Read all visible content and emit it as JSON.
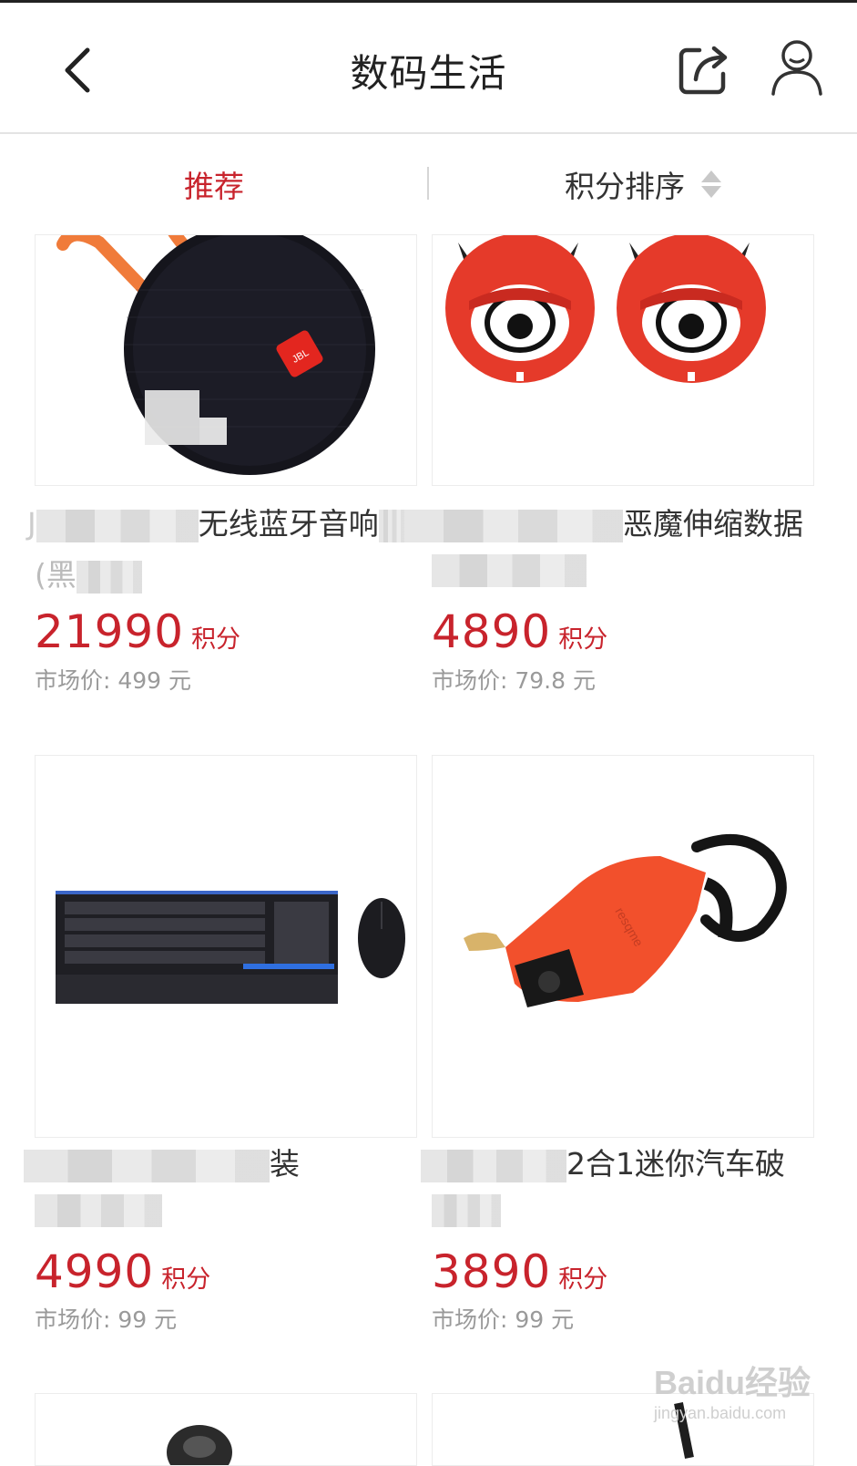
{
  "header": {
    "title": "数码生活"
  },
  "tabs": {
    "recommend": "推荐",
    "points_sort": "积分排序"
  },
  "products": [
    {
      "name_visible": "无线蓝牙音响",
      "name_line2_visible": "(黑",
      "name_prefix_visible": "J",
      "price_points": "21990",
      "points_unit": "积分",
      "market_price": "市场价: 499 元",
      "image": "black-round-bluetooth-speaker"
    },
    {
      "name_visible": "恶魔伸缩数据",
      "name_line2_visible": "",
      "price_points": "4890",
      "points_unit": "积分",
      "market_price": "市场价: 79.8 元",
      "image": "red-devil-cable-winders"
    },
    {
      "name_visible": "装",
      "name_line2_visible": "",
      "price_points": "4990",
      "points_unit": "积分",
      "market_price": "市场价: 99 元",
      "image": "keyboard-and-mouse-set"
    },
    {
      "name_visible": "2合1迷你汽车破",
      "name_line2_visible": "",
      "price_points": "3890",
      "points_unit": "积分",
      "market_price": "市场价: 99 元",
      "image": "red-car-safety-hammer"
    }
  ],
  "watermark": {
    "brand": "Baidu经验",
    "url": "jingyan.baidu.com"
  },
  "colors": {
    "accent": "#c8232c",
    "text": "#333333",
    "muted": "#9a9a9a"
  }
}
